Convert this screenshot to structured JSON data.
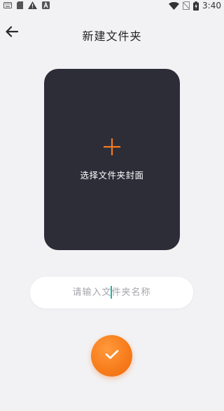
{
  "status_bar": {
    "time": "3:40",
    "left_icons": [
      "keyboard-icon",
      "sd-card-icon",
      "warning-icon",
      "font-icon"
    ],
    "right_icons": [
      "wifi-icon",
      "no-sim-icon",
      "battery-charging-icon"
    ]
  },
  "header": {
    "title": "新建文件夹",
    "back_icon": "arrow-left-icon"
  },
  "cover": {
    "label": "选择文件夹封面",
    "icon": "plus-icon",
    "background_color": "#2d2d38",
    "icon_color": "#f47b20"
  },
  "folder_name": {
    "value": "",
    "placeholder": "请输入文件夹名称"
  },
  "confirm": {
    "icon": "checkmark-icon",
    "color": "#f77d1c"
  }
}
